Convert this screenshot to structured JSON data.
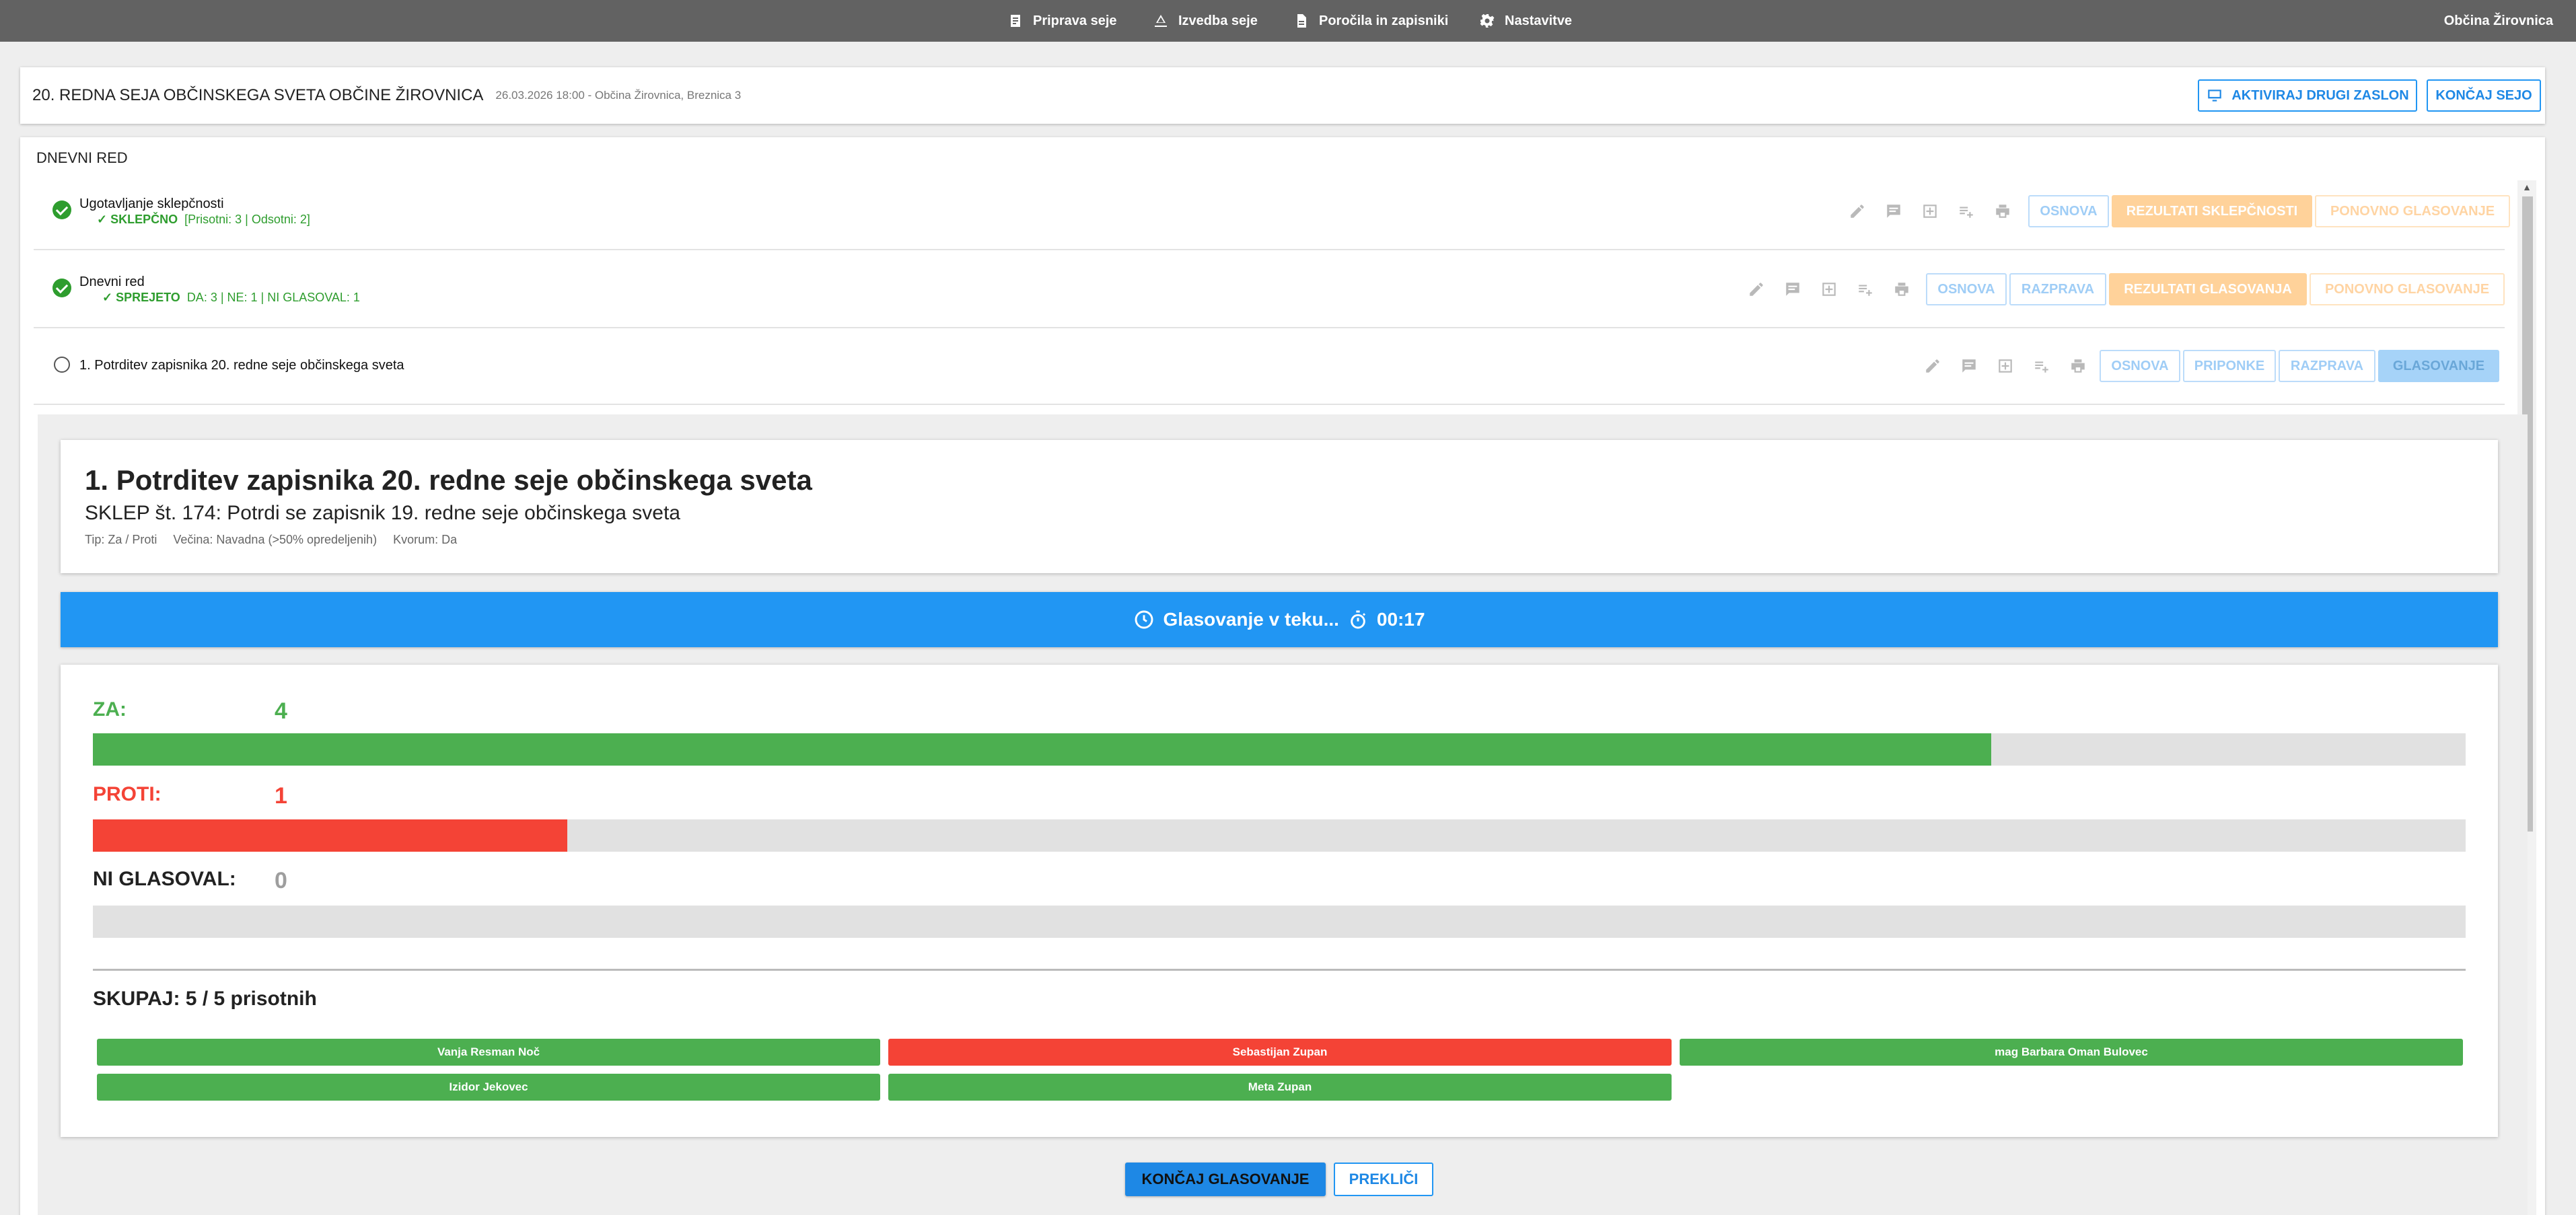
{
  "topbar": {
    "nav": [
      {
        "label": "Priprava seje",
        "icon": "document-list-icon"
      },
      {
        "label": "Izvedba seje",
        "icon": "gavel-icon"
      },
      {
        "label": "Poročila in zapisniki",
        "icon": "file-icon"
      },
      {
        "label": "Nastavitve",
        "icon": "gear-icon"
      }
    ],
    "org": "Občina Žirovnica"
  },
  "session": {
    "title": "20. REDNA SEJA OBČINSKEGA SVETA OBČINE ŽIROVNICA",
    "subtitle": "26.03.2026 18:00 - Občina Žirovnica, Breznica 3",
    "btn_screen": "AKTIVIRAJ DRUGI ZASLON",
    "btn_end": "KONČAJ SEJO"
  },
  "agenda": {
    "heading": "DNEVNI RED",
    "items": [
      {
        "title": "Ugotavljanje sklepčnosti",
        "status_label": "✓ SKLEPČNO",
        "status_detail": "[Prisotni: 3 | Odsotni: 2]",
        "buttons": [
          "OSNOVA",
          "REZULTATI SKLEPČNOSTI",
          "PONOVNO GLASOVANJE"
        ]
      },
      {
        "title": "Dnevni red",
        "status_label": "✓ SPREJETO",
        "status_detail": "DA: 3 | NE: 1 | NI GLASOVAL: 1",
        "buttons": [
          "OSNOVA",
          "RAZPRAVA",
          "REZULTATI GLASOVANJA",
          "PONOVNO GLASOVANJE"
        ]
      },
      {
        "title": "1. Potrditev zapisnika 20. redne seje občinskega sveta",
        "buttons": [
          "OSNOVA",
          "PRIPONKE",
          "RAZPRAVA",
          "GLASOVANJE"
        ]
      }
    ]
  },
  "detail": {
    "title": "1. Potrditev zapisnika 20. redne seje občinskega sveta",
    "resolution": "SKLEP št. 174: Potrdi se zapisnik 19. redne seje občinskega sveta",
    "type": "Tip: Za / Proti",
    "majority": "Večina: Navadna (>50% opredeljenih)",
    "quorum": "Kvorum: Da"
  },
  "voting": {
    "status": "Glasovanje v teku...",
    "timer": "00:17",
    "for_label": "ZA:",
    "for_count": "4",
    "against_label": "PROTI:",
    "against_count": "1",
    "none_label": "NI GLASOVAL:",
    "none_count": "0",
    "total": "SKUPAJ: 5 / 5 prisotnih",
    "for_fraction": 0.8,
    "against_fraction": 0.2,
    "none_fraction": 0,
    "colors": {
      "for": "#4caf50",
      "against": "#f44336",
      "none": "#9e9e9e"
    },
    "voters": [
      {
        "name": "Vanja Resman Noč",
        "vote": "za"
      },
      {
        "name": "Sebastijan Zupan",
        "vote": "proti"
      },
      {
        "name": "mag Barbara Oman Bulovec",
        "vote": "za"
      },
      {
        "name": "Izidor Jekovec",
        "vote": "za"
      },
      {
        "name": "Meta Zupan",
        "vote": "za"
      }
    ],
    "btn_finish": "KONČAJ GLASOVANJE",
    "btn_cancel": "PREKLIČI"
  }
}
